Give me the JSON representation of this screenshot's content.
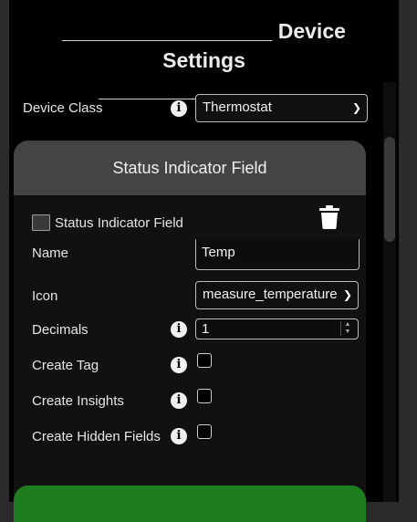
{
  "title": "__________________ Device Settings __________________",
  "device_class": {
    "label": "Device Class",
    "value": "Thermostat"
  },
  "card": {
    "header": "Status Indicator Field",
    "status_checkbox_label": "Status Indicator Field",
    "name": {
      "label": "Name",
      "value": "Temp"
    },
    "icon": {
      "label": "Icon",
      "value": "measure_temperature"
    },
    "decimals": {
      "label": "Decimals",
      "value": "1"
    },
    "create_tag": {
      "label": "Create Tag"
    },
    "create_insights": {
      "label": "Create Insights"
    },
    "create_hidden_fields": {
      "label": "Create Hidden Fields"
    }
  },
  "colors": {
    "save_button": "#1e7d1e",
    "card_header": "#444444"
  },
  "icons": {
    "info": "info-icon",
    "trash": "trash-icon",
    "chevron": "chevron-down-icon"
  }
}
